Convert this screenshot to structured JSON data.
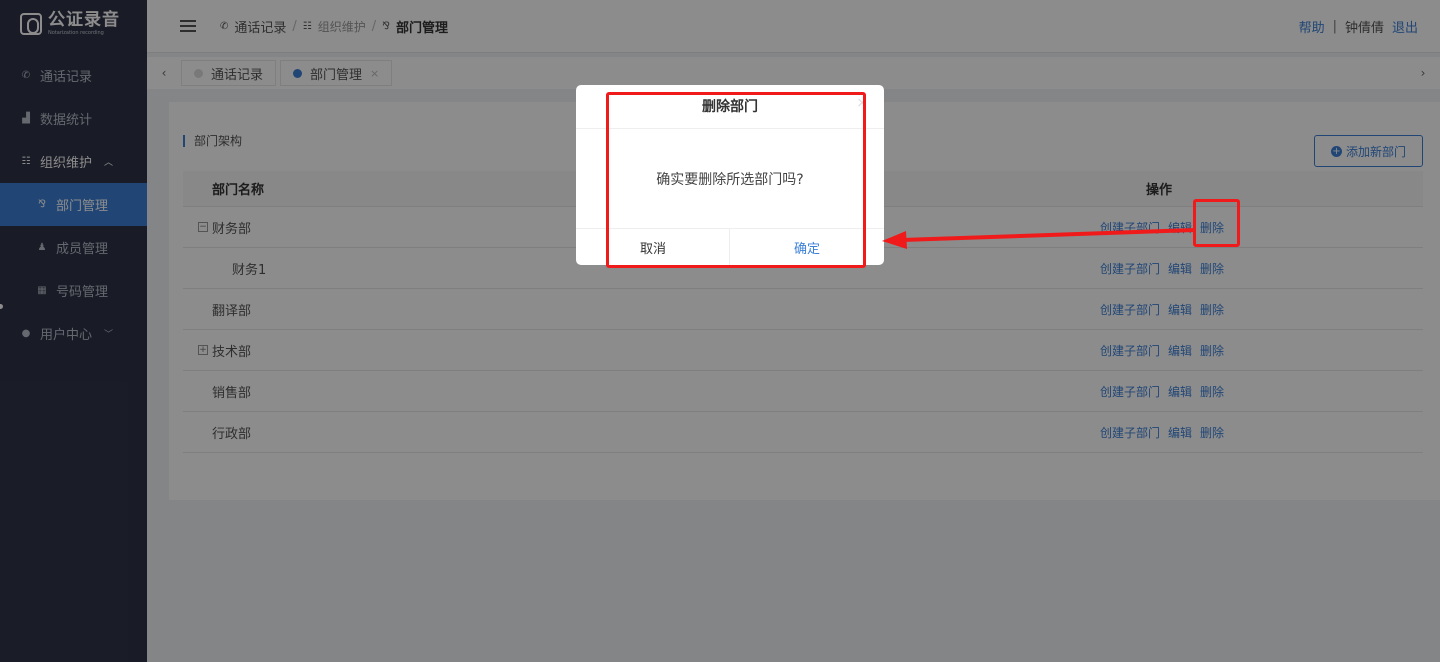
{
  "logo": {
    "title": "公证录音",
    "subtitle": "Notarization recording"
  },
  "sidebar": {
    "items": [
      {
        "label": "通话记录",
        "icon": "phone-icon"
      },
      {
        "label": "数据统计",
        "icon": "chart-icon"
      },
      {
        "label": "组织维护",
        "icon": "org-icon",
        "expanded": true
      },
      {
        "label": "部门管理",
        "icon": "dept-icon",
        "active": true
      },
      {
        "label": "成员管理",
        "icon": "users-icon"
      },
      {
        "label": "号码管理",
        "icon": "grid-icon"
      },
      {
        "label": "用户中心",
        "icon": "user-circle-icon"
      }
    ]
  },
  "header": {
    "breadcrumb": [
      "通话记录",
      "组织维护",
      "部门管理"
    ],
    "help": "帮助",
    "username": "钟倩倩",
    "logout": "退出"
  },
  "tabs": [
    {
      "label": "通话记录"
    },
    {
      "label": "部门管理",
      "active": true,
      "close": "×"
    }
  ],
  "main": {
    "section_title": "部门架构",
    "add_button": "添加新部门",
    "columns": [
      "部门名称",
      "操作"
    ],
    "rows": [
      {
        "name": "财务部",
        "tree": "minus"
      },
      {
        "name": "财务1",
        "tree": "child"
      },
      {
        "name": "翻译部",
        "tree": "none"
      },
      {
        "name": "技术部",
        "tree": "plus"
      },
      {
        "name": "销售部",
        "tree": "none"
      },
      {
        "name": "行政部",
        "tree": "none"
      }
    ],
    "actions": {
      "create_child": "创建子部门",
      "edit": "编辑",
      "delete": "删除"
    }
  },
  "modal": {
    "title": "删除部门",
    "message": "确实要删除所选部门吗?",
    "cancel": "取消",
    "confirm": "确定",
    "close": "×"
  },
  "colors": {
    "accent": "#3d80d8",
    "sidebar_bg": "#2f3447",
    "annotation": "#f01a1a"
  }
}
